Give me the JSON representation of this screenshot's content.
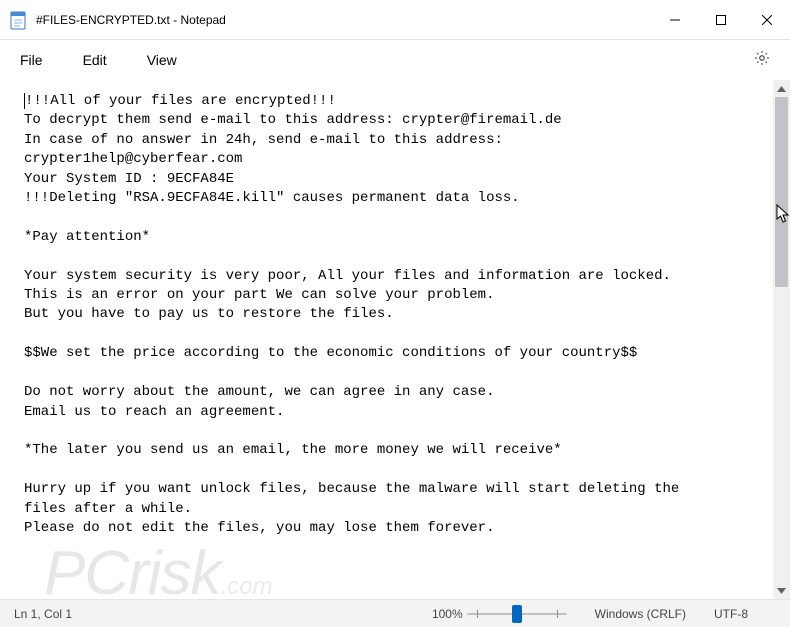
{
  "window": {
    "title": "#FILES-ENCRYPTED.txt - Notepad"
  },
  "menu": {
    "file": "File",
    "edit": "Edit",
    "view": "View"
  },
  "content": {
    "lines": [
      "!!!All of your files are encrypted!!!",
      "To decrypt them send e-mail to this address: crypter@firemail.de",
      "In case of no answer in 24h, send e-mail to this address:",
      "crypter1help@cyberfear.com",
      "Your System ID : 9ECFA84E",
      "!!!Deleting \"RSA.9ECFA84E.kill\" causes permanent data loss.",
      "",
      "*Pay attention*",
      "",
      "Your system security is very poor, All your files and information are locked.",
      "This is an error on your part We can solve your problem.",
      "But you have to pay us to restore the files.",
      "",
      "$$We set the price according to the economic conditions of your country$$",
      "",
      "Do not worry about the amount, we can agree in any case.",
      "Email us to reach an agreement.",
      "",
      "*The later you send us an email, the more money we will receive*",
      "",
      "Hurry up if you want unlock files, because the malware will start deleting the",
      "files after a while.",
      "Please do not edit the files, you may lose them forever.",
      ""
    ]
  },
  "status": {
    "pos": "Ln 1, Col 1",
    "zoom": "100%",
    "eol": "Windows (CRLF)",
    "encoding": "UTF-8"
  },
  "watermark": {
    "big": "PCrisk",
    "small": ".com"
  }
}
